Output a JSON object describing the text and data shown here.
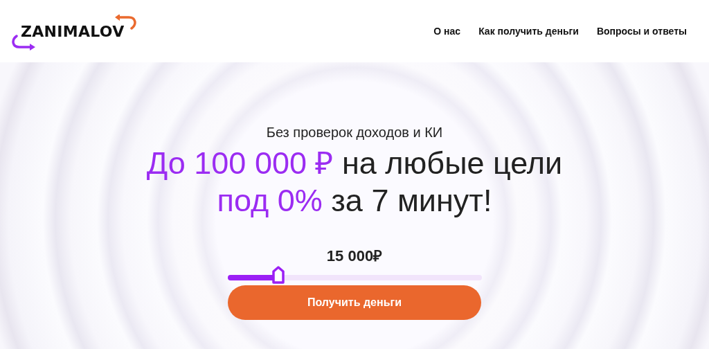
{
  "logo": {
    "text": "ZANIMALOV"
  },
  "nav": [
    {
      "label": "О нас"
    },
    {
      "label": "Как получить деньги"
    },
    {
      "label": "Вопросы и ответы"
    }
  ],
  "hero": {
    "subtitle": "Без проверок доходов и КИ",
    "headline": [
      [
        {
          "text": "До 100 000 ₽",
          "accent": true
        },
        {
          "text": " на любые цели",
          "accent": false
        }
      ],
      [
        {
          "text": "под 0%",
          "accent": true
        },
        {
          "text": " за 7 минут!",
          "accent": false
        }
      ]
    ],
    "amount": "15 000₽",
    "slider": {
      "level": 0.2
    },
    "button": "Получить деньги"
  }
}
